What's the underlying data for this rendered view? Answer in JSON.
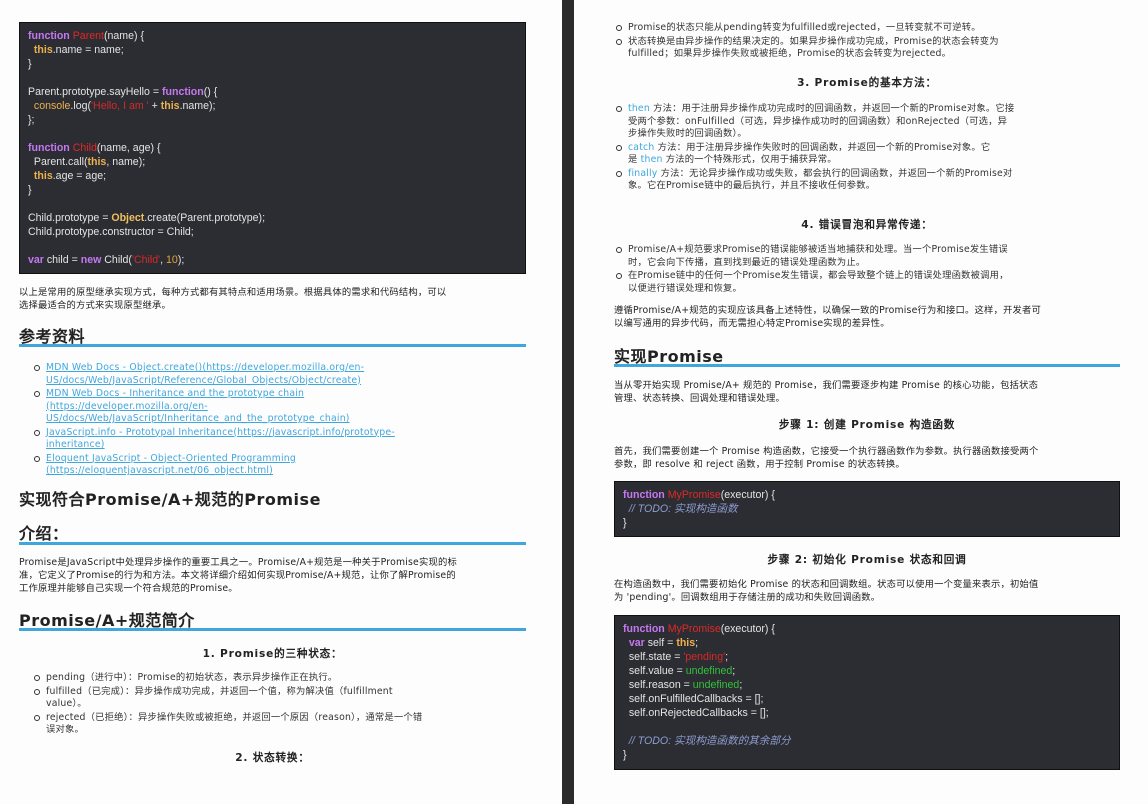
{
  "left": {
    "code1": [
      [
        {
          "t": "function",
          "c": "kw"
        },
        {
          "t": " "
        },
        {
          "t": "Parent",
          "c": "fn"
        },
        {
          "t": "(name) {"
        }
      ],
      [
        {
          "t": "  "
        },
        {
          "t": "this",
          "c": "th"
        },
        {
          "t": ".name = name;"
        }
      ],
      [
        {
          "t": "}"
        }
      ],
      [],
      [
        {
          "t": "Parent.prototype.sayHello = "
        },
        {
          "t": "function",
          "c": "kw"
        },
        {
          "t": "() {"
        }
      ],
      [
        {
          "t": "  "
        },
        {
          "t": "console",
          "c": "bi"
        },
        {
          "t": ".log("
        },
        {
          "t": "'Hello, I am '",
          "c": "str"
        },
        {
          "t": " + "
        },
        {
          "t": "this",
          "c": "th"
        },
        {
          "t": ".name);"
        }
      ],
      [
        {
          "t": "};"
        }
      ],
      [],
      [
        {
          "t": "function",
          "c": "kw"
        },
        {
          "t": " "
        },
        {
          "t": "Child",
          "c": "fn"
        },
        {
          "t": "(name, age) {"
        }
      ],
      [
        {
          "t": "  Parent.call("
        },
        {
          "t": "this",
          "c": "th"
        },
        {
          "t": ", name);"
        }
      ],
      [
        {
          "t": "  "
        },
        {
          "t": "this",
          "c": "th"
        },
        {
          "t": ".age = age;"
        }
      ],
      [
        {
          "t": "}"
        }
      ],
      [],
      [
        {
          "t": "Child.prototype = "
        },
        {
          "t": "Object",
          "c": "obj"
        },
        {
          "t": ".create(Parent.prototype);"
        }
      ],
      [
        {
          "t": "Child.prototype.constructor = Child;"
        }
      ],
      [],
      [
        {
          "t": "var",
          "c": "kw"
        },
        {
          "t": " child = "
        },
        {
          "t": "new",
          "c": "kw"
        },
        {
          "t": " Child("
        },
        {
          "t": "'Child'",
          "c": "str"
        },
        {
          "t": ", "
        },
        {
          "t": "10",
          "c": "num"
        },
        {
          "t": ");"
        }
      ]
    ],
    "summary_1": "以上是常用的原型继承实现方式，每种方式都有其特点和适用场景。根据具体的需求和代码结构，可以",
    "summary_2": "选择最适合的方式来实现原型继承。",
    "references_heading": "参考资料",
    "refs": [
      [
        "MDN Web Docs - Object.create()(https://developer.mozilla.org/en-",
        "US/docs/Web/JavaScript/Reference/Global_Objects/Object/create)"
      ],
      [
        "MDN Web Docs - Inheritance and the prototype chain",
        "(https://developer.mozilla.org/en-",
        "US/docs/Web/JavaScript/Inheritance_and_the_prototype_chain)"
      ],
      [
        "JavaScript.info - Prototypal Inheritance(https://javascript.info/prototype-",
        "inheritance)"
      ],
      [
        "Eloquent JavaScript - Object-Oriented Programming",
        "(https://eloquentjavascript.net/06_object.html)"
      ]
    ],
    "promise_title": "实现符合Promise/A+规范的Promise",
    "intro_heading": "介绍：",
    "intro_1": "Promise是JavaScript中处理异步操作的重要工具之一。Promise/A+规范是一种关于Promise实现的标",
    "intro_2": "准，它定义了Promise的行为和方法。本文将详细介绍如何实现Promise/A+规范，让你了解Promise的",
    "intro_3": "工作原理并能够自己实现一个符合规范的Promise。",
    "spec_heading": "Promise/A+规范简介",
    "states_heading": "1. Promise的三种状态：",
    "states": [
      [
        "pending（进行中）：Promise的初始状态，表示异步操作正在执行。"
      ],
      [
        "fulfilled（已完成）：异步操作成功完成，并返回一个值，称为解决值（fulfillment",
        "value）。"
      ],
      [
        "rejected（已拒绝）：异步操作失败或被拒绝，并返回一个原因（reason），通常是一个错",
        "误对象。"
      ]
    ],
    "transition_heading": "2. 状态转换："
  },
  "right": {
    "transitions": [
      [
        "Promise的状态只能从pending转变为fulfilled或rejected，一旦转变就不可逆转。"
      ],
      [
        "状态转换是由异步操作的结果决定的。如果异步操作成功完成，Promise的状态会转变为",
        "fulfilled；如果异步操作失败或被拒绝，Promise的状态会转变为rejected。"
      ]
    ],
    "methods_heading": "3. Promise的基本方法：",
    "methods": [
      {
        "name": "then",
        "lines": [
          "方法：用于注册异步操作成功完成时的回调函数，并返回一个新的Promise对象。它接",
          "受两个参数：onFulfilled（可选，异步操作成功时的回调函数）和onRejected（可选，异",
          "步操作失败时的回调函数）。"
        ]
      },
      {
        "name": "catch",
        "lines": [
          "方法：用于注册异步操作失败时的回调函数，并返回一个新的Promise对象。它",
          "是",
          "方法的一个特殊形式，仅用于捕获异常。"
        ],
        "inline": "then"
      },
      {
        "name": "finally",
        "lines": [
          "方法：无论异步操作成功或失败，都会执行的回调函数，并返回一个新的Promise对",
          "象。它在Promise链中的最后执行，并且不接收任何参数。"
        ]
      }
    ],
    "errors_heading": "4. 错误冒泡和异常传递：",
    "errors": [
      [
        "Promise/A+规范要求Promise的错误能够被适当地捕获和处理。当一个Promise发生错误",
        "时，它会向下传播，直到找到最近的错误处理函数为止。"
      ],
      [
        "在Promise链中的任何一个Promise发生错误，都会导致整个链上的错误处理函数被调用，",
        "以便进行错误处理和恢复。"
      ]
    ],
    "conclusion_1": "遵循Promise/A+规范的实现应该具备上述特性，以确保一致的Promise行为和接口。这样，开发者可",
    "conclusion_2": "以编写通用的异步代码，而无需担心特定Promise实现的差异性。",
    "impl_heading": "实现Promise",
    "impl_1": "当从零开始实现 Promise/A+ 规范的 Promise，我们需要逐步构建 Promise 的核心功能，包括状态",
    "impl_2": "管理、状态转换、回调处理和错误处理。",
    "step1_heading": "步骤 1: 创建 Promise 构造函数",
    "step1_1": "首先，我们需要创建一个 Promise 构造函数，它接受一个执行器函数作为参数。执行器函数接受两个",
    "step1_2": "参数，即 resolve 和 reject 函数，用于控制 Promise 的状态转换。",
    "code2": [
      [
        {
          "t": "function",
          "c": "kw"
        },
        {
          "t": " "
        },
        {
          "t": "MyPromise",
          "c": "fn"
        },
        {
          "t": "(executor) {"
        }
      ],
      [
        {
          "t": "  "
        },
        {
          "t": "// TODO: 实现构造函数",
          "c": "cm"
        }
      ],
      [
        {
          "t": "}"
        }
      ]
    ],
    "step2_heading": "步骤 2: 初始化 Promise 状态和回调",
    "step2_1": "在构造函数中，我们需要初始化 Promise 的状态和回调数组。状态可以使用一个变量来表示，初始值",
    "step2_2": "为 'pending'。回调数组用于存储注册的成功和失败回调函数。",
    "code3": [
      [
        {
          "t": "function",
          "c": "kw"
        },
        {
          "t": " "
        },
        {
          "t": "MyPromise",
          "c": "fn"
        },
        {
          "t": "(executor) {"
        }
      ],
      [
        {
          "t": "  "
        },
        {
          "t": "var",
          "c": "kw"
        },
        {
          "t": " self = "
        },
        {
          "t": "this",
          "c": "th"
        },
        {
          "t": ";"
        }
      ],
      [
        {
          "t": "  self.state = "
        },
        {
          "t": "'pending'",
          "c": "str"
        },
        {
          "t": ";"
        }
      ],
      [
        {
          "t": "  self.value = "
        },
        {
          "t": "undefined",
          "c": "und"
        },
        {
          "t": ";"
        }
      ],
      [
        {
          "t": "  self.reason = "
        },
        {
          "t": "undefined",
          "c": "und"
        },
        {
          "t": ";"
        }
      ],
      [
        {
          "t": "  self.onFulfilledCallbacks = [];"
        }
      ],
      [
        {
          "t": "  self.onRejectedCallbacks = [];"
        }
      ],
      [],
      [
        {
          "t": "  "
        },
        {
          "t": "// TODO: 实现构造函数的其余部分",
          "c": "cm"
        }
      ],
      [
        {
          "t": "}"
        }
      ]
    ]
  }
}
